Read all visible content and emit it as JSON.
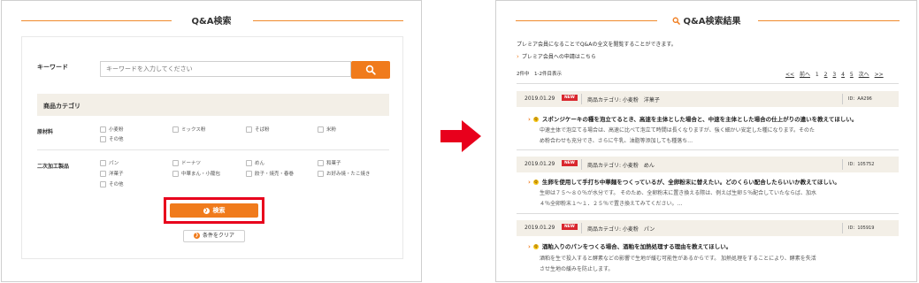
{
  "left": {
    "title": "Q&A検索",
    "keyword_label": "キーワード",
    "keyword_placeholder": "キーワードを入力してください",
    "category_header": "商品カテゴリ",
    "raw_label": "原材料",
    "raw_items": [
      "小麦粉",
      "ミックス粉",
      "そば粉",
      "米粉",
      "その他"
    ],
    "processed_label": "二次加工製品",
    "processed_items": [
      "パン",
      "ドーナツ",
      "めん",
      "和菓子",
      "洋菓子",
      "中華まん・小籠包",
      "餃子・焼売・春巻",
      "お好み焼・たこ焼き",
      "その他"
    ],
    "search_button": "検索",
    "clear_button": "条件をクリア"
  },
  "right": {
    "title": "Q&A検索結果",
    "premium_note": "プレミア会員になることでQ&Aの全文を閲覧することができます。",
    "premium_link": "プレミア会員への申請はこちら",
    "result_count": "2件中　1-2件目表示",
    "pager": {
      "first": "<<",
      "prev": "前へ",
      "pages": [
        "1",
        "2",
        "3",
        "4",
        "5"
      ],
      "next": "次へ",
      "last": ">>"
    },
    "results": [
      {
        "date": "2019.01.29",
        "badge": "NEW",
        "category": "商品カテゴリ: 小麦粉　洋菓子",
        "id": "ID：AA296",
        "question": "スポンジケーキの種を泡立てるとき、高速を主体とした場合と、中速を主体とした場合の仕上がりの違いを教えてほしい。",
        "answer1": "中速主体で泡立てる場合は、高速に比べて泡立て時間は長くなりますが、強く細かい安定した種になります。そのた",
        "answer2": "め粉合わせも充分でき、さらに牛乳、油脂等添加しても種落ち…"
      },
      {
        "date": "2019.01.29",
        "badge": "NEW",
        "category": "商品カテゴリ: 小麦粉　めん",
        "id": "ID：105752",
        "question": "生卵を使用して手打ち中華麺をつくっているが、全卵粉末に替えたい。どのくらい配合したらいいか教えてほしい。",
        "answer1": "生卵は７５～８０％が水分です。 そのため、全卵粉末に置き換える際は、例えば生卵５％配合していたならば、加水",
        "answer2": "４％全卵粉末１～１．２５％で置き換えてみてください。…"
      },
      {
        "date": "2019.01.29",
        "badge": "NEW",
        "category": "商品カテゴリ: 小麦粉　パン",
        "id": "ID：105919",
        "question": "酒粕入りのパンをつくる場合、酒粕を加熱処理する理由を教えてほしい。",
        "answer1": "酒粕を生で投入すると酵素などの影響で生地が緩む可能性があるからです。 加熱処理をすることにより、酵素を失活",
        "answer2": "させ生地の緩みを防止します。"
      }
    ]
  },
  "colors": {
    "accent": "#f07b1c",
    "highlight": "#e8001c",
    "header_bg": "#f3efe7",
    "arrow": "#e8001c"
  }
}
